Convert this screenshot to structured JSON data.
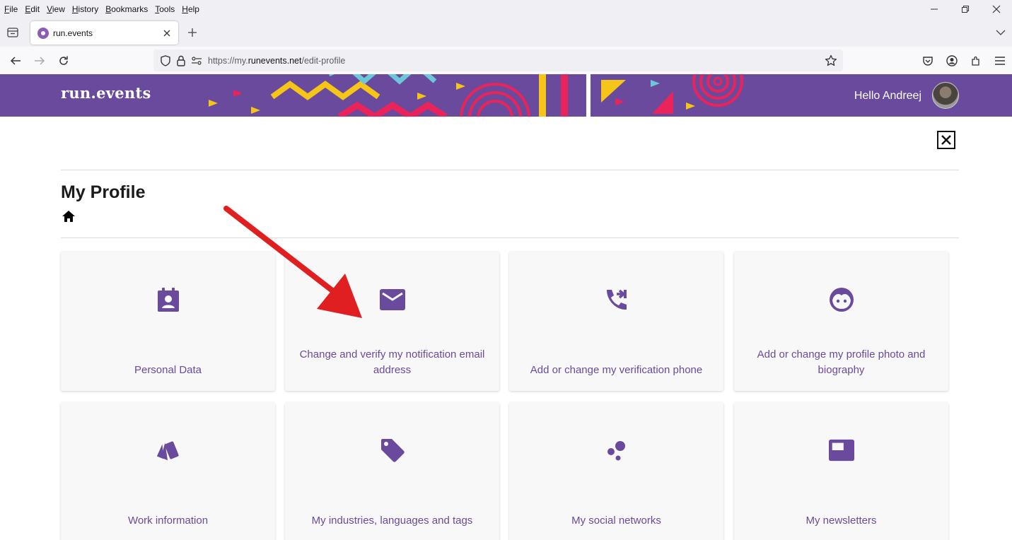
{
  "browser": {
    "menu": [
      "File",
      "Edit",
      "View",
      "History",
      "Bookmarks",
      "Tools",
      "Help"
    ],
    "tab_title": "run.events",
    "url_prefix": "https://my.",
    "url_host": "runevents.net",
    "url_path": "/edit-profile"
  },
  "header": {
    "logo": "run.events",
    "greeting": "Hello Andreej",
    "brand_color": "#6a4a9c"
  },
  "page": {
    "title": "My Profile"
  },
  "cards": [
    {
      "label": "Personal Data",
      "icon": "contact-calendar-icon"
    },
    {
      "label": "Change and verify my notification email address",
      "icon": "email-icon"
    },
    {
      "label": "Add or change my verification phone",
      "icon": "phone-forward-icon"
    },
    {
      "label": "Add or change my profile photo and biography",
      "icon": "face-icon"
    },
    {
      "label": "Work information",
      "icon": "cards-icon"
    },
    {
      "label": "My industries, languages and tags",
      "icon": "tag-icon"
    },
    {
      "label": "My social networks",
      "icon": "bubbles-icon"
    },
    {
      "label": "My newsletters",
      "icon": "newsletter-icon"
    }
  ],
  "annotation": {
    "arrow_color": "#e02020"
  }
}
